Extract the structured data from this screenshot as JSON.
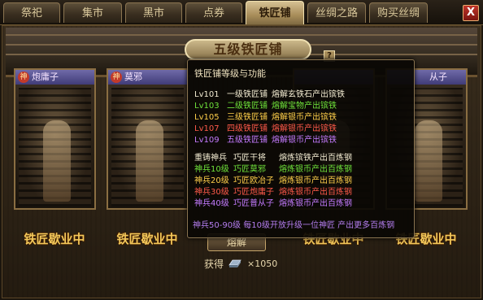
{
  "tabs": [
    {
      "label": "祭祀",
      "active": false
    },
    {
      "label": "集市",
      "active": false
    },
    {
      "label": "黑市",
      "active": false
    },
    {
      "label": "点券",
      "active": false
    },
    {
      "label": "铁匠铺",
      "active": true
    },
    {
      "label": "丝绸之路",
      "active": false
    },
    {
      "label": "购买丝绸",
      "active": false
    }
  ],
  "close_label": "X",
  "title": "五级铁匠铺",
  "help_label": "?",
  "smiths": [
    {
      "badge": "神",
      "name": "炮庸子",
      "status": "铁匠歇业中"
    },
    {
      "badge": "神",
      "name": "莫邪",
      "status": "铁匠歇业中"
    },
    {
      "badge": "",
      "name": "",
      "status": "铁匠歇业中"
    },
    {
      "badge": "",
      "name": "从子",
      "status": "铁匠歇业中"
    }
  ],
  "smelt_button": "熔解",
  "gain": {
    "label": "获得",
    "count": "×1050",
    "icon": "steel-ingot-icon"
  },
  "tooltip": {
    "title": "铁匠铺等级与功能",
    "levels": [
      {
        "lv": "Lv101",
        "name": "一级铁匠铺",
        "desc": "熔解玄铁石产出镔铁",
        "color": "#f3ecd2"
      },
      {
        "lv": "Lv103",
        "name": "二级铁匠铺",
        "desc": "熔解宝物产出镔铁",
        "color": "#6fe23a"
      },
      {
        "lv": "Lv105",
        "name": "三级铁匠铺",
        "desc": "熔解银币产出镔铁",
        "color": "#ffcf4a"
      },
      {
        "lv": "Lv107",
        "name": "四级铁匠铺",
        "desc": "熔解银币产出镔铁",
        "color": "#ff5a4a"
      },
      {
        "lv": "Lv109",
        "name": "五级铁匠铺",
        "desc": "熔解银币产出镔铁",
        "color": "#c47bff"
      }
    ],
    "recast": [
      {
        "req": "重铸神兵",
        "smith": "巧匠干将",
        "desc": "熔炼镔铁产出百炼钢",
        "color": "#f3ecd2"
      },
      {
        "req": "神兵10级",
        "smith": "巧匠莫邪",
        "desc": "熔炼银币产出百炼钢",
        "color": "#6fe23a"
      },
      {
        "req": "神兵20级",
        "smith": "巧匠欧冶子",
        "desc": "熔炼银币产出百炼钢",
        "color": "#ffcf4a"
      },
      {
        "req": "神兵30级",
        "smith": "巧匠炮庸子",
        "desc": "熔炼银币产出百炼钢",
        "color": "#ff5a4a"
      },
      {
        "req": "神兵40级",
        "smith": "巧匠普从子",
        "desc": "熔炼银币产出百炼钢",
        "color": "#c47bff"
      }
    ],
    "footer": "神兵50-90级 每10级开放升级一位神匠 产出更多百炼钢"
  }
}
